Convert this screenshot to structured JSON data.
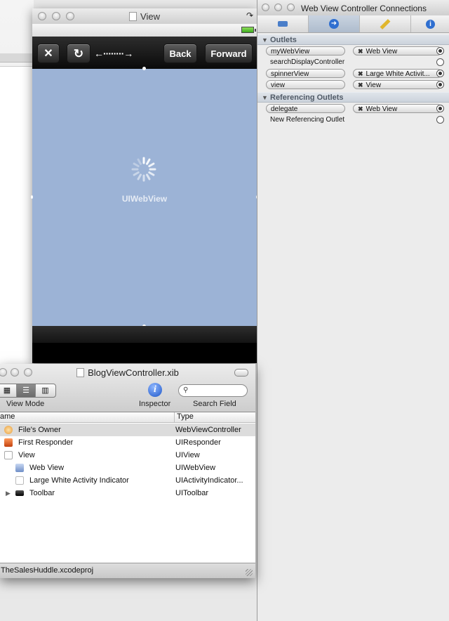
{
  "view_window": {
    "title": "View",
    "toolbar": {
      "close_label": "✕",
      "reload_label": "↻",
      "arrows_label": "←········→",
      "back_label": "Back",
      "forward_label": "Forward"
    },
    "webview_label": "UIWebView"
  },
  "connections_panel": {
    "title": "Web View Controller Connections",
    "tabs": [
      "attributes-icon",
      "connections-icon",
      "size-icon",
      "identity-icon"
    ],
    "outlets_header": "Outlets",
    "outlets": [
      {
        "name": "myWebView",
        "target": "Web View",
        "connected": true
      },
      {
        "name": "searchDisplayController",
        "target": "",
        "connected": false
      },
      {
        "name": "spinnerView",
        "target": "Large White Activit...",
        "connected": true
      },
      {
        "name": "view",
        "target": "View",
        "connected": true
      }
    ],
    "referencing_header": "Referencing Outlets",
    "referencing": [
      {
        "name": "delegate",
        "target": "Web View",
        "connected": true
      },
      {
        "name": "New Referencing Outlet",
        "target": "",
        "connected": false
      }
    ]
  },
  "xib_window": {
    "title": "BlogViewController.xib",
    "view_mode_label": "View Mode",
    "inspector_label": "Inspector",
    "search_label": "Search Field",
    "search_placeholder": "",
    "col_name": "ame",
    "col_type": "Type",
    "rows": [
      {
        "name": "File's Owner",
        "type": "WebViewController",
        "indent": 0,
        "selected": true
      },
      {
        "name": "First Responder",
        "type": "UIResponder",
        "indent": 0,
        "selected": false
      },
      {
        "name": "View",
        "type": "UIView",
        "indent": 0,
        "selected": false
      },
      {
        "name": "Web View",
        "type": "UIWebView",
        "indent": 1,
        "selected": false
      },
      {
        "name": "Large White Activity Indicator",
        "type": "UIActivityIndicator...",
        "indent": 1,
        "selected": false
      },
      {
        "name": "Toolbar",
        "type": "UIToolbar",
        "indent": 1,
        "selected": false
      }
    ],
    "status": "TheSalesHuddle.xcodeproj"
  },
  "colors": {
    "webview_bg": "#9cb3d6",
    "toolbar_bg": "#1a1a1a",
    "section_header": "#505a66"
  }
}
